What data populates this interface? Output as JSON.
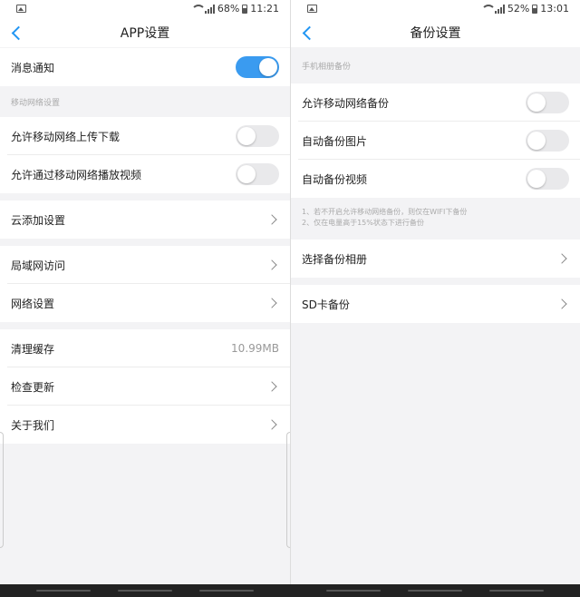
{
  "left": {
    "status": {
      "battery": "68%",
      "time": "11:21"
    },
    "title": "APP设置",
    "notification": {
      "label": "消息通知",
      "on": true
    },
    "mobile_section_header": "移动网络设置",
    "mobile_items": [
      {
        "label": "允许移动网络上传下载",
        "on": false
      },
      {
        "label": "允许通过移动网络播放视频",
        "on": false
      }
    ],
    "cloud_add": "云添加设置",
    "lan_access": "局域网访问",
    "network_settings": "网络设置",
    "clear_cache": {
      "label": "清理缓存",
      "value": "10.99MB"
    },
    "check_update": "检查更新",
    "about_us": "关于我们"
  },
  "right": {
    "status": {
      "battery": "52%",
      "time": "13:01"
    },
    "title": "备份设置",
    "section_header": "手机相册备份",
    "items": [
      {
        "label": "允许移动网络备份",
        "on": false
      },
      {
        "label": "自动备份图片",
        "on": false
      },
      {
        "label": "自动备份视频",
        "on": false
      }
    ],
    "notes": [
      "1、若不开启允许移动网络备份，则仅在WIFI下备份",
      "2、仅在电量高于15%状态下进行备份"
    ],
    "select_album": "选择备份相册",
    "sd_backup": "SD卡备份"
  },
  "colors": {
    "accent": "#3a9bf0",
    "back_arrow": "#2196f3",
    "background": "#f3f3f5"
  }
}
